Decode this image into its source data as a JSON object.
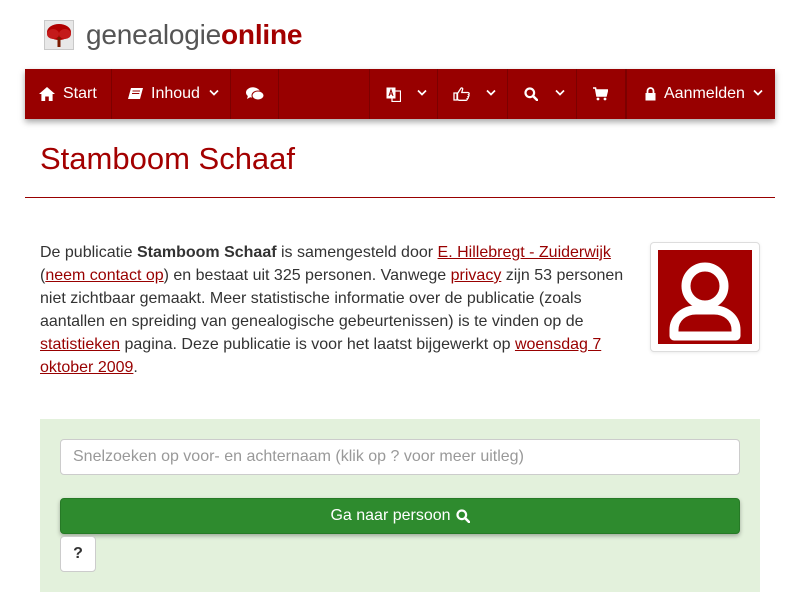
{
  "logo": {
    "text_gray": "genealogie",
    "text_red": "online",
    "icon": "tree-logo-icon"
  },
  "nav": {
    "start": "Start",
    "inhoud": "Inhoud",
    "login": "Aanmelden",
    "icons": [
      "home-icon",
      "book-icon",
      "comments-icon",
      "language-icon",
      "thumbs-up-icon",
      "search-icon",
      "cart-icon",
      "lock-icon"
    ]
  },
  "page": {
    "title": "Stamboom Schaaf"
  },
  "intro": {
    "t1": "De publicatie ",
    "pub_name": "Stamboom Schaaf",
    "t2": " is samengesteld door ",
    "author_link": "E. Hillebregt - Zuiderwijk",
    "t3": " (",
    "contact_link": "neem contact op",
    "t4": ") en bestaat uit 325 personen. Vanwege ",
    "privacy_link": "privacy",
    "t5": " zijn 53 personen niet zichtbaar gemaakt. Meer statistische informatie over de publicatie (zoals aantallen en spreiding van genealogische gebeurtenissen) is te vinden op de ",
    "stats_link": "statistieken",
    "t6": " pagina. Deze publicatie is voor het laatst bijgewerkt op ",
    "date_link": "woensdag 7 oktober 2009",
    "t7": "."
  },
  "search": {
    "placeholder": "Snelzoeken op voor- en achternaam (klik op ? voor meer uitleg)",
    "value": "",
    "go_label": "Ga naar persoon",
    "help_label": "?"
  },
  "colors": {
    "brand": "#980000",
    "title": "#a30000",
    "panel": "#e3f1dc",
    "go": "#2e8b2e"
  }
}
